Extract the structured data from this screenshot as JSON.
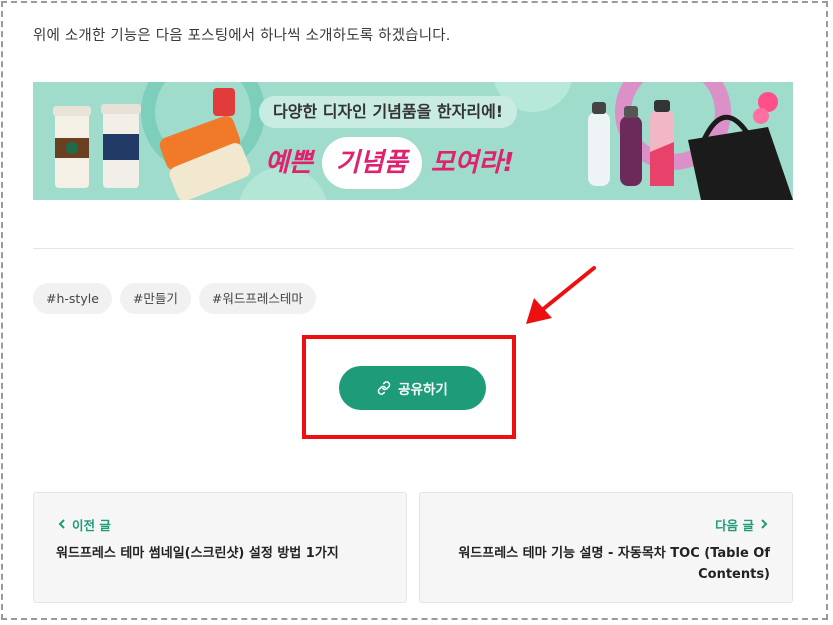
{
  "intro_text": "위에 소개한 기능은 다음 포스팅에서 하나씩 소개하도록 하겠습니다.",
  "banner": {
    "headline": "다양한 디자인 기념품을 한자리에!",
    "slogan_start": "예쁜",
    "slogan_mid": "기념품",
    "slogan_end": "모여라!",
    "background_color": "#9fdccb",
    "accent_color": "#e0226e"
  },
  "tags": [
    "#h-style",
    "#만들기",
    "#워드프레스테마"
  ],
  "share": {
    "label": "공유하기",
    "icon": "link-icon",
    "color": "#1e9b78"
  },
  "annotation": {
    "highlight_color": "#ee1010",
    "arrow_icon": "red-arrow-icon"
  },
  "post_nav": {
    "prev_label": "이전 글",
    "prev_title": "워드프레스 테마 썸네일(스크린샷) 설정 방법 1가지",
    "next_label": "다음 글",
    "next_title": "워드프레스 테마 기능 설명 - 자동목차 TOC (Table Of Contents)"
  }
}
